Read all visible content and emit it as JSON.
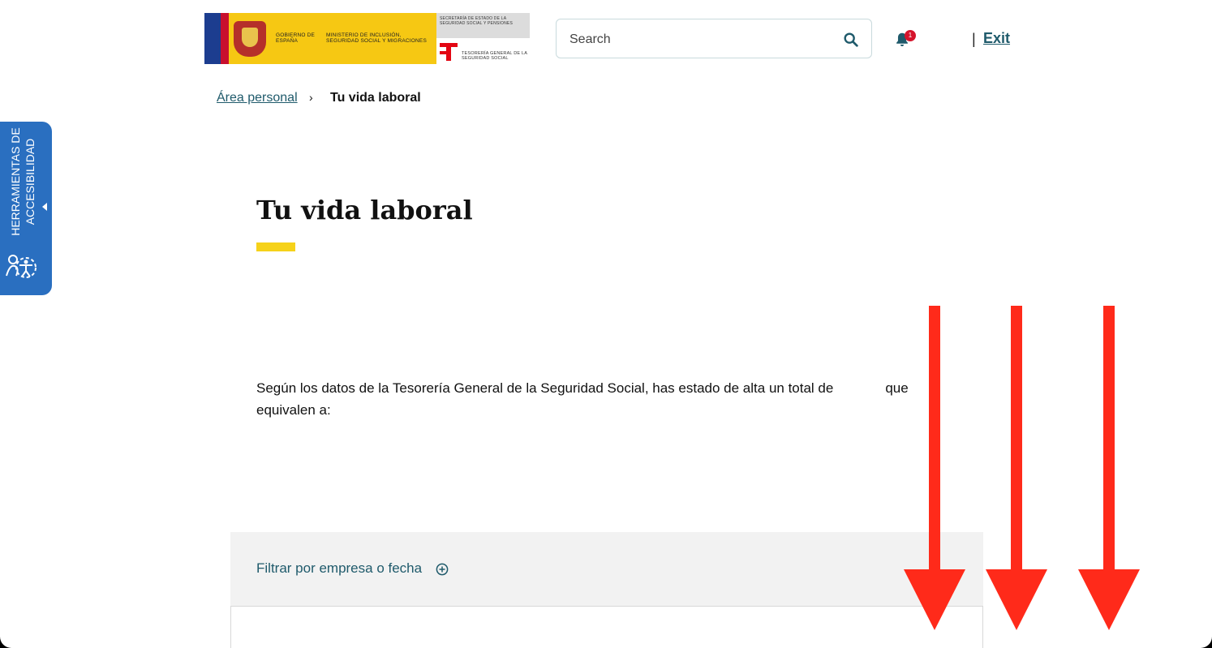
{
  "header": {
    "logo": {
      "gobierno": "GOBIERNO DE ESPAÑA",
      "ministerio": "MINISTERIO DE INCLUSIÓN, SEGURIDAD SOCIAL Y MIGRACIONES",
      "secretaria": "SECRETARÍA DE ESTADO DE LA SEGURIDAD SOCIAL Y PENSIONES",
      "tesoreria": "TESORERÍA GENERAL DE LA SEGURIDAD SOCIAL"
    },
    "search": {
      "placeholder": "Search",
      "icon": "search-icon"
    },
    "notifications": {
      "icon": "bell-icon",
      "count": "1"
    },
    "separator": "|",
    "exit_label": "Exit"
  },
  "breadcrumb": {
    "parent": "Área personal",
    "chevron": "›",
    "current": "Tu vida laboral"
  },
  "accessibility": {
    "label": "HERRAMIENTAS DE ACCESIBILIDAD",
    "icon": "accessibility-icon"
  },
  "main": {
    "title": "Tu vida laboral",
    "paragraph_start": "Según los datos de la Tesorería General de la Seguridad Social, has estado de alta un total de",
    "paragraph_end": "que equivalen a:"
  },
  "filter": {
    "label": "Filtrar por empresa o fecha",
    "icon": "plus-circle-icon"
  },
  "colors": {
    "link": "#1f5a6b",
    "accent_yellow": "#f6d21a",
    "a11y_blue": "#2a6fc0",
    "badge_red": "#d5142c",
    "arrow_red": "#ff2a1a"
  },
  "annotations": {
    "arrow_count": 3,
    "arrow_icon": "down-arrow-icon"
  }
}
